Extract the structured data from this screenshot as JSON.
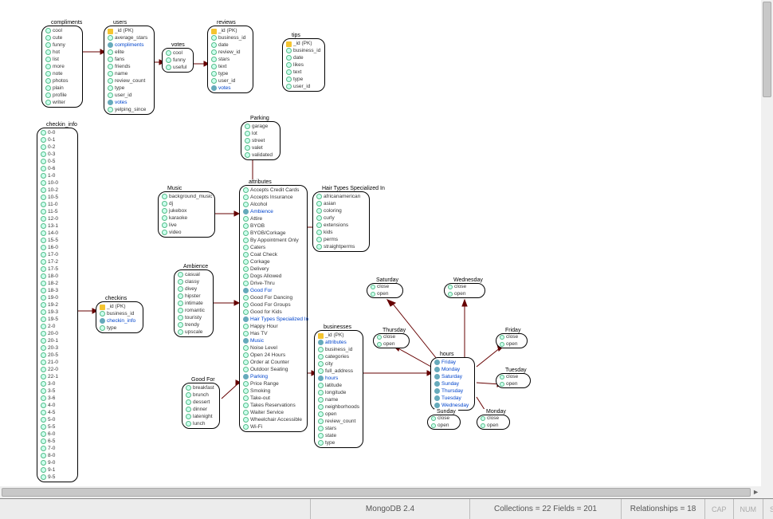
{
  "statusbar": {
    "db": "MongoDB 2.4",
    "collections": "Collections = 22  Fields = 201",
    "relationships": "Relationships = 18",
    "cap": "CAP",
    "num": "NUM",
    "scrl": "SCRL"
  },
  "entities": {
    "compliments": {
      "title": "compliments",
      "fields": [
        "cool",
        "cute",
        "funny",
        "hot",
        "list",
        "more",
        "note",
        "photos",
        "plain",
        "profile",
        "writer"
      ]
    },
    "users": {
      "title": "users",
      "pk": "_id (PK)",
      "fields": [
        "average_stars",
        "compliments",
        "elite",
        "fans",
        "friends",
        "name",
        "review_count",
        "type",
        "user_id",
        "votes",
        "yelping_since"
      ],
      "links": [
        "compliments",
        "votes"
      ]
    },
    "votes": {
      "title": "votes",
      "fields": [
        "cool",
        "funny",
        "useful"
      ]
    },
    "reviews": {
      "title": "reviews",
      "pk": "_id (PK)",
      "fields": [
        "business_id",
        "date",
        "review_id",
        "stars",
        "text",
        "type",
        "user_id",
        "votes"
      ],
      "links": [
        "votes"
      ]
    },
    "tips": {
      "title": "tips",
      "pk": "_id (PK)",
      "fields": [
        "business_id",
        "date",
        "likes",
        "text",
        "type",
        "user_id"
      ]
    },
    "checkin_info": {
      "title": "checkin_info",
      "fields": [
        "0-0",
        "0-1",
        "0-2",
        "0-3",
        "0-5",
        "0-6",
        "1-0",
        "10-0",
        "10-2",
        "10-5",
        "11-0",
        "11-5",
        "12-0",
        "13-1",
        "14-0",
        "15-5",
        "16-0",
        "17-0",
        "17-2",
        "17-5",
        "18-0",
        "18-2",
        "18-3",
        "19-0",
        "19-2",
        "19-3",
        "19-5",
        "2-0",
        "20-0",
        "20-1",
        "20-3",
        "20-5",
        "21-0",
        "22-0",
        "22-1",
        "3-0",
        "3-5",
        "3-6",
        "4-0",
        "4-5",
        "5-0",
        "5-5",
        "6-0",
        "6-5",
        "7-0",
        "8-0",
        "9-0",
        "9-1",
        "9-5"
      ]
    },
    "checkins": {
      "title": "checkins",
      "pk": "_id (PK)",
      "fields": [
        "business_id",
        "checkin_info",
        "type"
      ],
      "links": [
        "checkin_info"
      ]
    },
    "parking": {
      "title": "Parking",
      "fields": [
        "garage",
        "lot",
        "street",
        "valet",
        "validated"
      ]
    },
    "music": {
      "title": "Music",
      "fields": [
        "background_music",
        "dj",
        "jukebox",
        "karaoke",
        "live",
        "video"
      ]
    },
    "ambience": {
      "title": "Ambience",
      "fields": [
        "casual",
        "classy",
        "divey",
        "hipster",
        "intimate",
        "romantic",
        "touristy",
        "trendy",
        "upscale"
      ]
    },
    "goodfor": {
      "title": "Good For",
      "fields": [
        "breakfast",
        "brunch",
        "dessert",
        "dinner",
        "latenight",
        "lunch"
      ]
    },
    "hairtypes": {
      "title": "Hair Types Specialized In",
      "fields": [
        "africanamerican",
        "asian",
        "coloring",
        "curly",
        "extensions",
        "kids",
        "perms",
        "straightperms"
      ]
    },
    "attributes": {
      "title": "attributes",
      "fields": [
        "Accepts Credit Cards",
        "Accepts Insurance",
        "Alcohol",
        "Ambience",
        "Attire",
        "BYOB",
        "BYOB/Corkage",
        "By Appointment Only",
        "Caters",
        "Coat Check",
        "Corkage",
        "Delivery",
        "Dogs Allowed",
        "Drive-Thru",
        "Good For",
        "Good For Dancing",
        "Good For Groups",
        "Good for Kids",
        "Hair Types Specialized In",
        "Happy Hour",
        "Has TV",
        "Music",
        "Noise Level",
        "Open 24 Hours",
        "Order at Counter",
        "Outdoor Seating",
        "Parking",
        "Price Range",
        "Smoking",
        "Take-out",
        "Takes Reservations",
        "Waiter Service",
        "Wheelchair Accessible",
        "Wi-Fi"
      ],
      "links": [
        "Ambience",
        "Good For",
        "Hair Types Specialized In",
        "Music",
        "Parking"
      ]
    },
    "businesses": {
      "title": "businesses",
      "pk": "_id (PK)",
      "fields": [
        "attributes",
        "business_id",
        "categories",
        "city",
        "full_address",
        "hours",
        "latitude",
        "longitude",
        "name",
        "neighborhoods",
        "open",
        "review_count",
        "stars",
        "state",
        "type"
      ],
      "links": [
        "attributes",
        "hours"
      ]
    },
    "hours": {
      "title": "hours",
      "fields": [
        "Friday",
        "Monday",
        "Saturday",
        "Sunday",
        "Thursday",
        "Tuesday",
        "Wednesday"
      ],
      "all_links": true
    },
    "day": {
      "close": "close",
      "open": "open"
    },
    "days": {
      "Saturday": "Saturday",
      "Wednesday": "Wednesday",
      "Thursday": "Thursday",
      "Friday": "Friday",
      "Tuesday": "Tuesday",
      "Sunday": "Sunday",
      "Monday": "Monday"
    }
  }
}
